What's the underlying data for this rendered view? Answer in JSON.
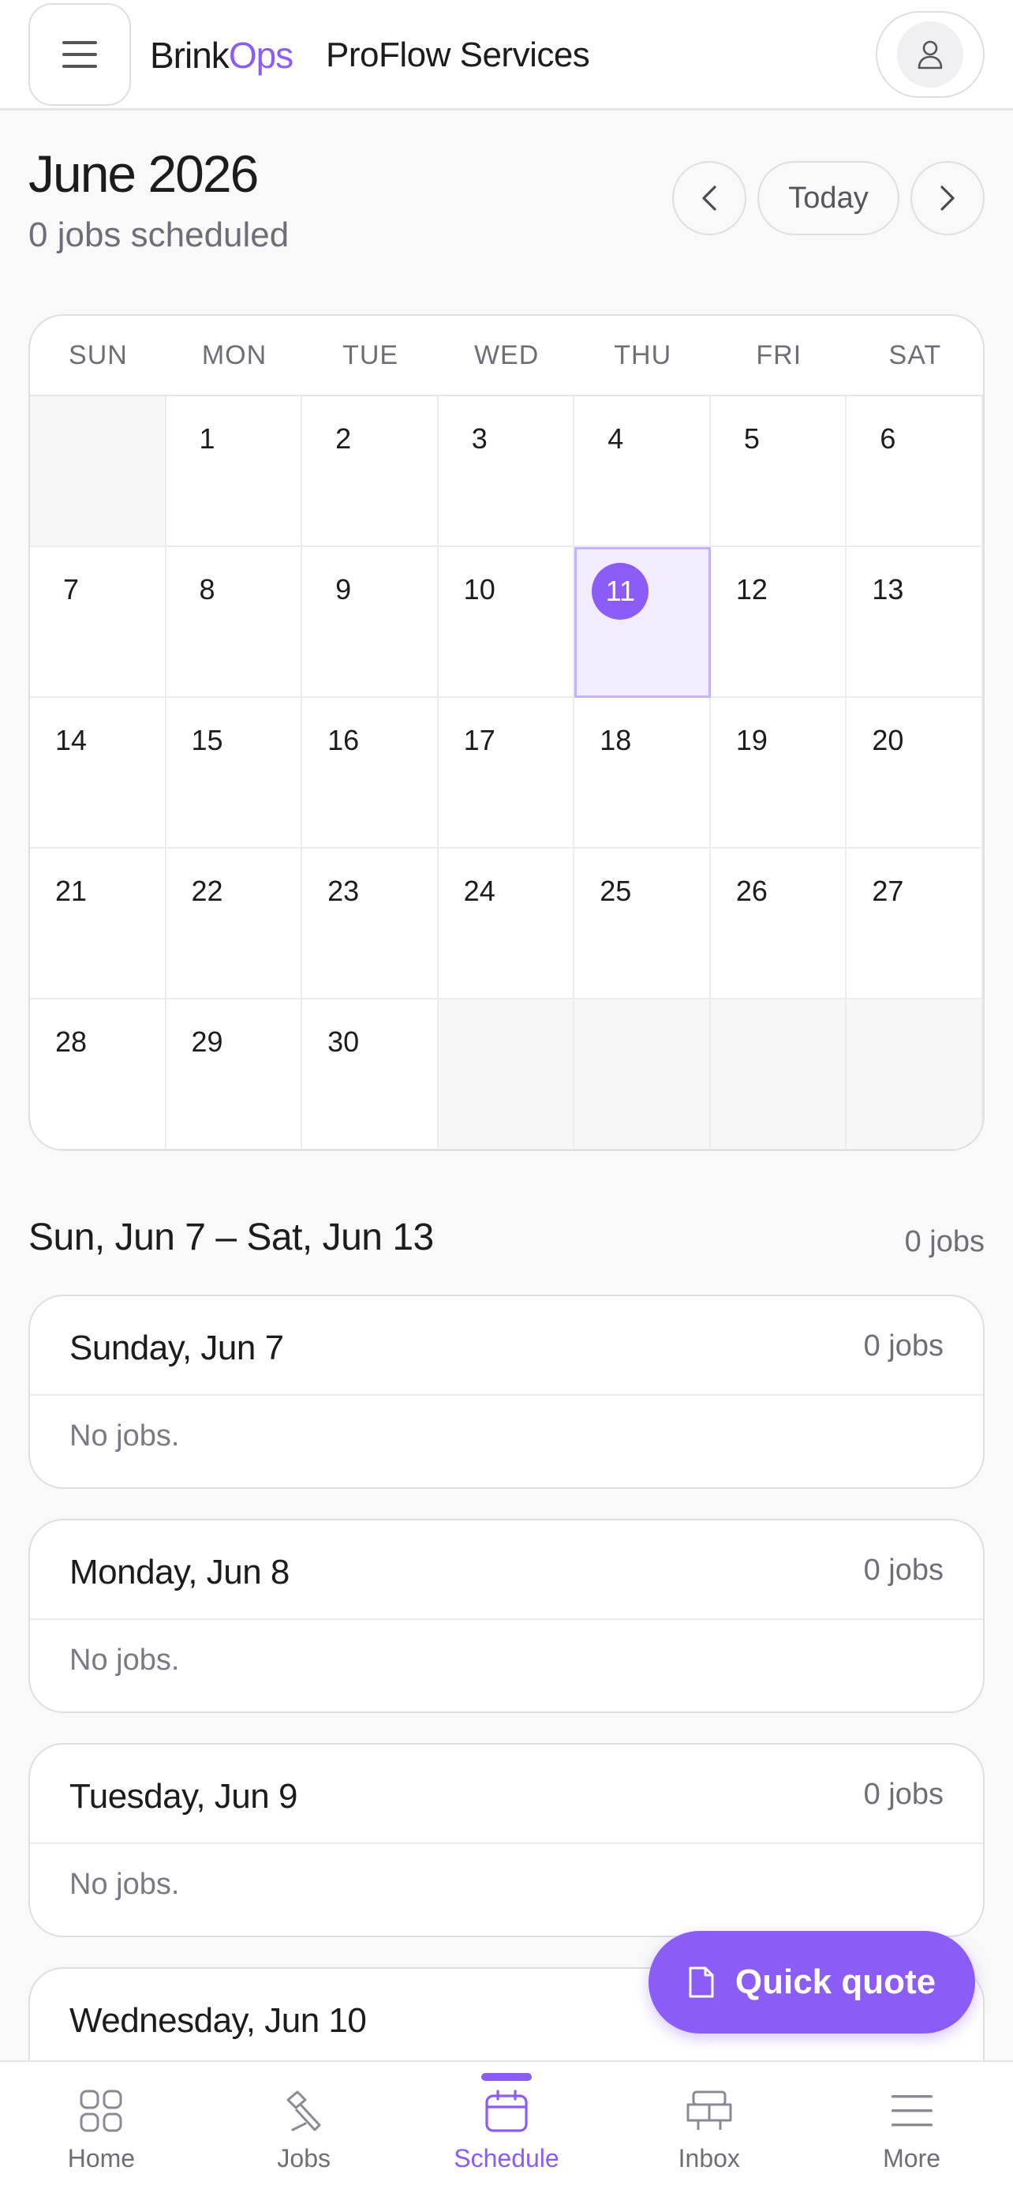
{
  "header": {
    "brand_prefix": "Brink",
    "brand_suffix": "Ops",
    "org_name": "ProFlow Services",
    "brand_color": "#8b5cf6"
  },
  "month": {
    "title": "June 2026",
    "subtitle": "0 jobs scheduled",
    "today_label": "Today"
  },
  "calendar": {
    "weekdays": [
      "SUN",
      "MON",
      "TUE",
      "WED",
      "THU",
      "FRI",
      "SAT"
    ],
    "weeks": [
      [
        "",
        "1",
        "2",
        "3",
        "4",
        "5",
        "6"
      ],
      [
        "7",
        "8",
        "9",
        "10",
        "11",
        "12",
        "13"
      ],
      [
        "14",
        "15",
        "16",
        "17",
        "18",
        "19",
        "20"
      ],
      [
        "21",
        "22",
        "23",
        "24",
        "25",
        "26",
        "27"
      ],
      [
        "28",
        "29",
        "30",
        "",
        "",
        "",
        ""
      ]
    ],
    "selected_day": "11"
  },
  "week": {
    "title": "Sun, Jun 7 – Sat, Jun 13",
    "count": "0 jobs"
  },
  "days": [
    {
      "title": "Sunday, Jun 7",
      "count": "0 jobs",
      "empty_text": "No jobs."
    },
    {
      "title": "Monday, Jun 8",
      "count": "0 jobs",
      "empty_text": "No jobs."
    },
    {
      "title": "Tuesday, Jun 9",
      "count": "0 jobs",
      "empty_text": "No jobs."
    },
    {
      "title": "Wednesday, Jun 10",
      "count": "",
      "empty_text": ""
    }
  ],
  "fab": {
    "label": "Quick quote",
    "icon": "document-icon"
  },
  "bottom_nav": {
    "active": "Schedule",
    "items": [
      {
        "label": "Home",
        "icon": "grid-icon"
      },
      {
        "label": "Jobs",
        "icon": "tools-icon"
      },
      {
        "label": "Schedule",
        "icon": "calendar-icon"
      },
      {
        "label": "Inbox",
        "icon": "inbox-icon"
      },
      {
        "label": "More",
        "icon": "menu-icon"
      }
    ]
  }
}
